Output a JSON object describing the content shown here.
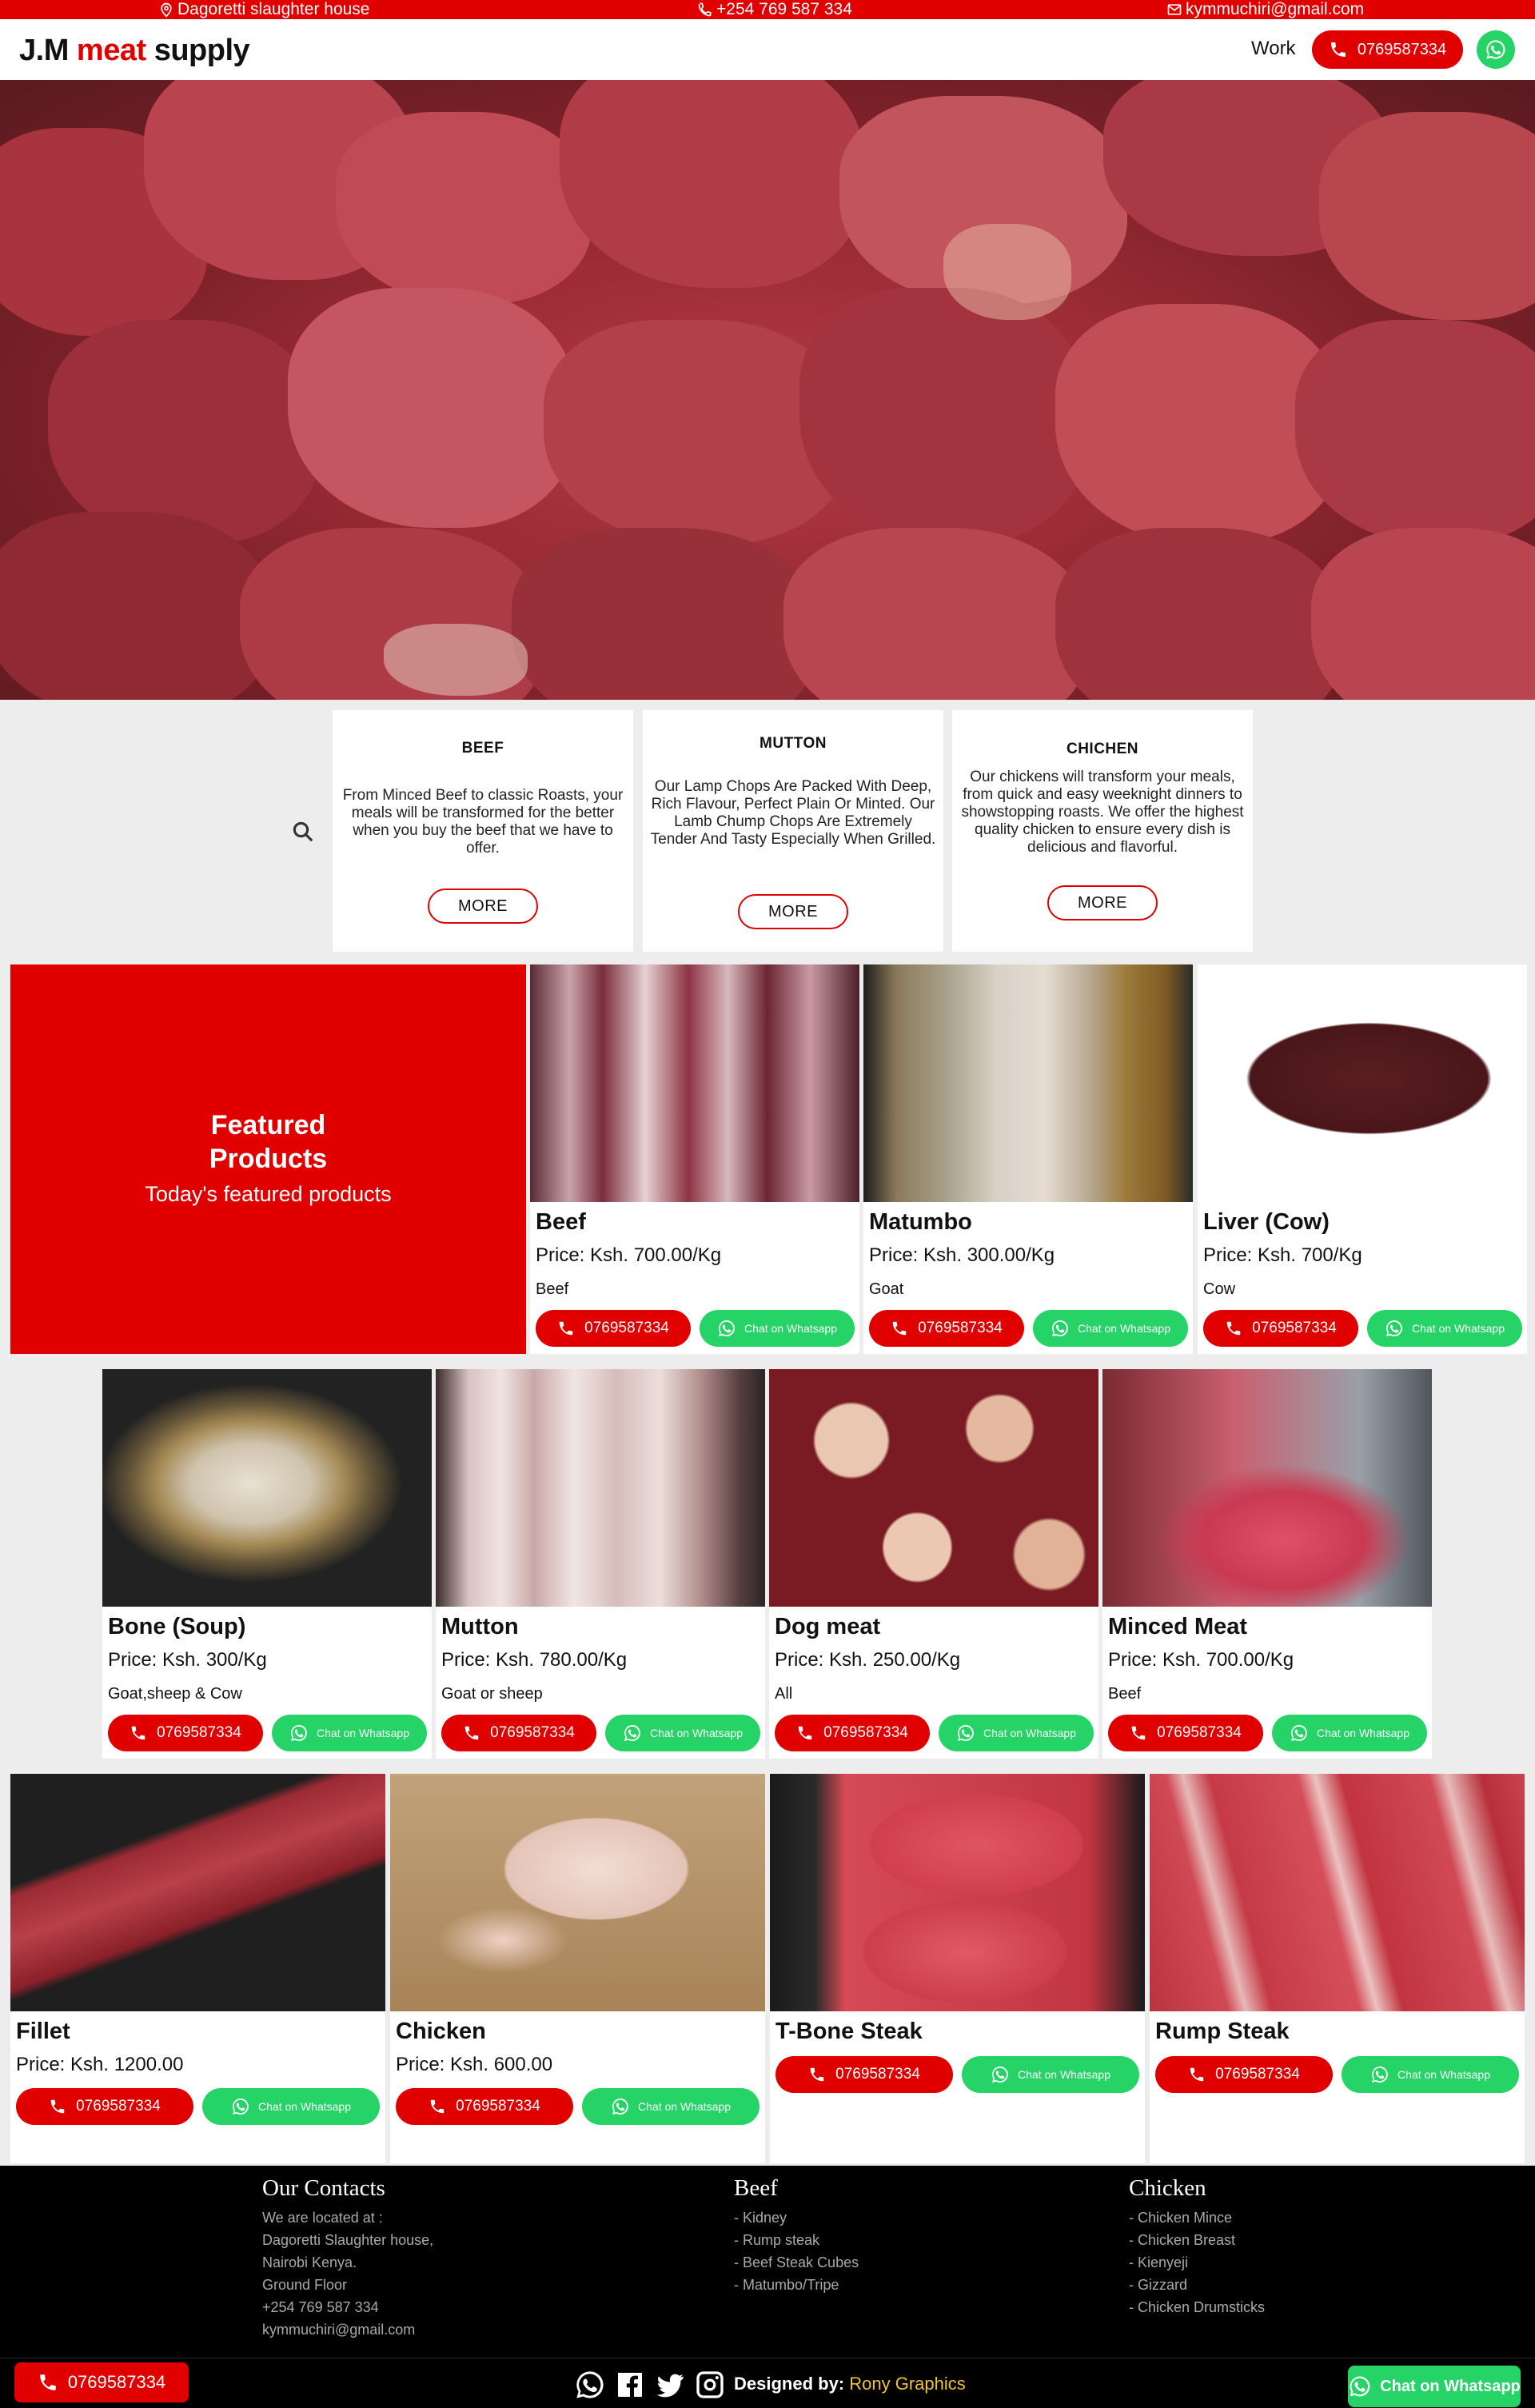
{
  "topbar": {
    "address": "Dagoretti slaughter house",
    "phone": "+254 769 587 334",
    "email": "kymmuchiri@gmail.com"
  },
  "header": {
    "brand_part1": "J.M",
    "brand_part2": "meat",
    "brand_part3": "supply",
    "nav_work": "Work",
    "call_label": "0769587334"
  },
  "categories": [
    {
      "title": "BEEF",
      "text": "From Minced Beef to classic Roasts, your meals will be transformed for the better when you buy the beef that we have to offer.",
      "button": "MORE"
    },
    {
      "title": "MUTTON",
      "text": "Our Lamp Chops Are Packed With Deep, Rich Flavour, Perfect Plain Or Minted. Our Lamb Chump Chops Are Extremely Tender And Tasty Especially When Grilled.",
      "button": "MORE"
    },
    {
      "title": "CHICHEN",
      "text": "Our chickens will transform your meals, from quick and easy weeknight dinners to showstopping roasts.  We offer the highest quality chicken to ensure every dish is delicious and flavorful.",
      "button": "MORE"
    }
  ],
  "featured": {
    "title_line1": "Featured",
    "title_line2": "Products",
    "subtitle": "Today's featured products"
  },
  "products_row1": [
    {
      "name": "Beef",
      "price": "Price: Ksh. 700.00/Kg",
      "category": "Beef",
      "call": "0769587334",
      "whatsapp": "Chat on Whatsapp"
    },
    {
      "name": "Matumbo",
      "price": "Price: Ksh. 300.00/Kg",
      "category": "Goat",
      "call": "0769587334",
      "whatsapp": "Chat on Whatsapp"
    },
    {
      "name": "Liver (Cow)",
      "price": "Price: Ksh. 700/Kg",
      "category": "Cow",
      "call": "0769587334",
      "whatsapp": "Chat on Whatsapp"
    }
  ],
  "products_row2": [
    {
      "name": "Bone (Soup)",
      "price": "Price: Ksh. 300/Kg",
      "category": "Goat,sheep & Cow",
      "call": "0769587334",
      "whatsapp": "Chat on Whatsapp"
    },
    {
      "name": "Mutton",
      "price": "Price: Ksh. 780.00/Kg",
      "category": "Goat or sheep",
      "call": "0769587334",
      "whatsapp": "Chat on Whatsapp"
    },
    {
      "name": "Dog meat",
      "price": "Price: Ksh. 250.00/Kg",
      "category": "All",
      "call": "0769587334",
      "whatsapp": "Chat on Whatsapp"
    },
    {
      "name": "Minced Meat",
      "price": "Price: Ksh. 700.00/Kg",
      "category": "Beef",
      "call": "0769587334",
      "whatsapp": "Chat on Whatsapp"
    }
  ],
  "products_row3": [
    {
      "name": "Fillet",
      "price": "Price: Ksh. 1200.00",
      "call": "0769587334",
      "whatsapp": "Chat on Whatsapp"
    },
    {
      "name": "Chicken",
      "price": "Price: Ksh. 600.00",
      "call": "0769587334",
      "whatsapp": "Chat on Whatsapp"
    },
    {
      "name": "T-Bone Steak",
      "call": "0769587334",
      "whatsapp": "Chat on Whatsapp"
    },
    {
      "name": "Rump Steak",
      "call": "0769587334",
      "whatsapp": "Chat on Whatsapp"
    }
  ],
  "footer": {
    "contacts_title": "Our Contacts",
    "contacts_lines": [
      "We are located at :",
      "Dagoretti Slaughter house,",
      "Nairobi Kenya.",
      "Ground Floor",
      "+254 769 587 334",
      "kymmuchiri@gmail.com"
    ],
    "beef_title": "Beef",
    "beef_lines": [
      "- Kidney",
      "- Rump steak",
      "- Beef Steak Cubes",
      "- Matumbo/Tripe"
    ],
    "chicken_title": "Chicken",
    "chicken_lines": [
      "- Chicken Mince",
      "- Chicken Breast",
      "- Kienyeji",
      "- Gizzard",
      "- Chicken Drumsticks"
    ],
    "call_label": "0769587334",
    "designed_by_label": "Designed by:",
    "designer": "Rony Graphics",
    "whatsapp_label": "Chat on Whatsapp"
  },
  "colors": {
    "accent": "#e00000",
    "whatsapp": "#25d366",
    "footer_bg": "#000000",
    "designer": "#f1c232"
  },
  "icons": [
    "location-icon",
    "phone-icon",
    "mail-icon",
    "whatsapp-icon",
    "search-icon",
    "facebook-icon",
    "twitter-icon",
    "instagram-icon"
  ]
}
